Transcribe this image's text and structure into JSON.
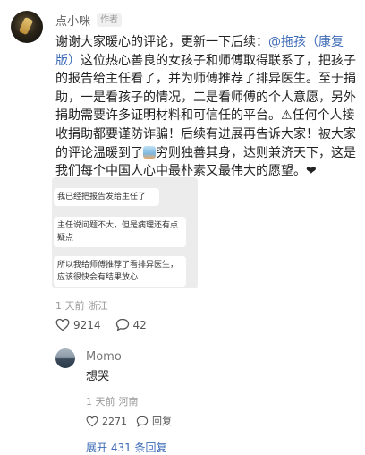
{
  "post": {
    "author": "点小咪",
    "author_badge": "作者",
    "text_a": "谢谢大家暖心的评论，更新一下后续：",
    "mention": "@拖孩（康复版）",
    "text_b": "这位热心善良的女孩子和师傅取得联系了，把孩子的报告给主任看了，并为师傅推荐了排异医生。至于捐助，一是看孩子的情况，二是看师傅的个人意愿，另外捐助需要许多证明材料和可信任的平台。⚠任何个人接收捐助都要谨防诈骗！后续有进展再告诉大家！被大家的评论温暖到了",
    "text_c": "穷则独善其身，达则兼济天下，这是我们每个中国人心中最朴素又最伟大的愿望。",
    "text_heart": "❤",
    "screenshot_messages": [
      "我已经把报告发给主任了",
      "主任说问题不大，但是病理还有点疑点",
      "所以我给师傅推荐了看排异医生，应该很快会有结果放心"
    ],
    "time": "1 天前",
    "location": "浙江",
    "likes": "9214",
    "comments": "42",
    "like_icon": "heart-outline-icon",
    "comment_icon": "comment-bubble-icon"
  },
  "reply": {
    "author": "Momo",
    "text": "想哭",
    "time": "1 天前",
    "location": "河南",
    "likes": "2271",
    "reply_label": "回复"
  },
  "expand_label": "展开 431 条回复",
  "colors": {
    "link": "#3e6bb7",
    "text": "#222222",
    "muted": "#999999"
  }
}
